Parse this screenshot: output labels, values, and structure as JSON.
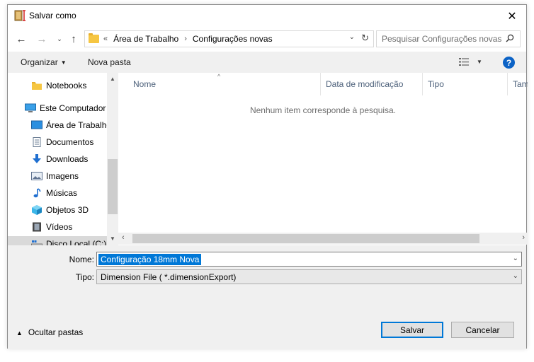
{
  "window": {
    "title": "Salvar como",
    "close_label": "✕"
  },
  "navigation": {
    "breadcrumb_overflow": "«",
    "breadcrumb": [
      "Área de Trabalho",
      "Configurações novas"
    ],
    "search_placeholder": "Pesquisar Configurações novas"
  },
  "toolbar": {
    "organize_label": "Organizar",
    "new_folder_label": "Nova pasta",
    "help_label": "?"
  },
  "nav_pane": {
    "items": [
      {
        "label": "Notebooks",
        "icon": "folder-icon"
      },
      {
        "label": "Este Computador",
        "icon": "computer-icon"
      },
      {
        "label": "Área de Trabalho",
        "icon": "desktop-icon"
      },
      {
        "label": "Documentos",
        "icon": "documents-icon"
      },
      {
        "label": "Downloads",
        "icon": "download-icon"
      },
      {
        "label": "Imagens",
        "icon": "pictures-icon"
      },
      {
        "label": "Músicas",
        "icon": "music-icon"
      },
      {
        "label": "Objetos 3D",
        "icon": "cube-icon"
      },
      {
        "label": "Vídeos",
        "icon": "video-icon"
      },
      {
        "label": "Disco Local (C:)",
        "icon": "drive-icon"
      }
    ]
  },
  "file_list": {
    "columns": [
      "Nome",
      "Data de modificação",
      "Tipo",
      "Tamanho"
    ],
    "empty_message": "Nenhum item corresponde à pesquisa."
  },
  "form": {
    "name_label": "Nome:",
    "name_value": "Configuração 18mm Nova",
    "type_label": "Tipo:",
    "type_value": "Dimension File  ( *.dimensionExport)"
  },
  "footer": {
    "hide_folders_label": "Ocultar pastas",
    "save_label": "Salvar",
    "cancel_label": "Cancelar"
  },
  "colors": {
    "accent": "#0078d7",
    "help": "#0c63c6",
    "folder": "#f6c642"
  }
}
